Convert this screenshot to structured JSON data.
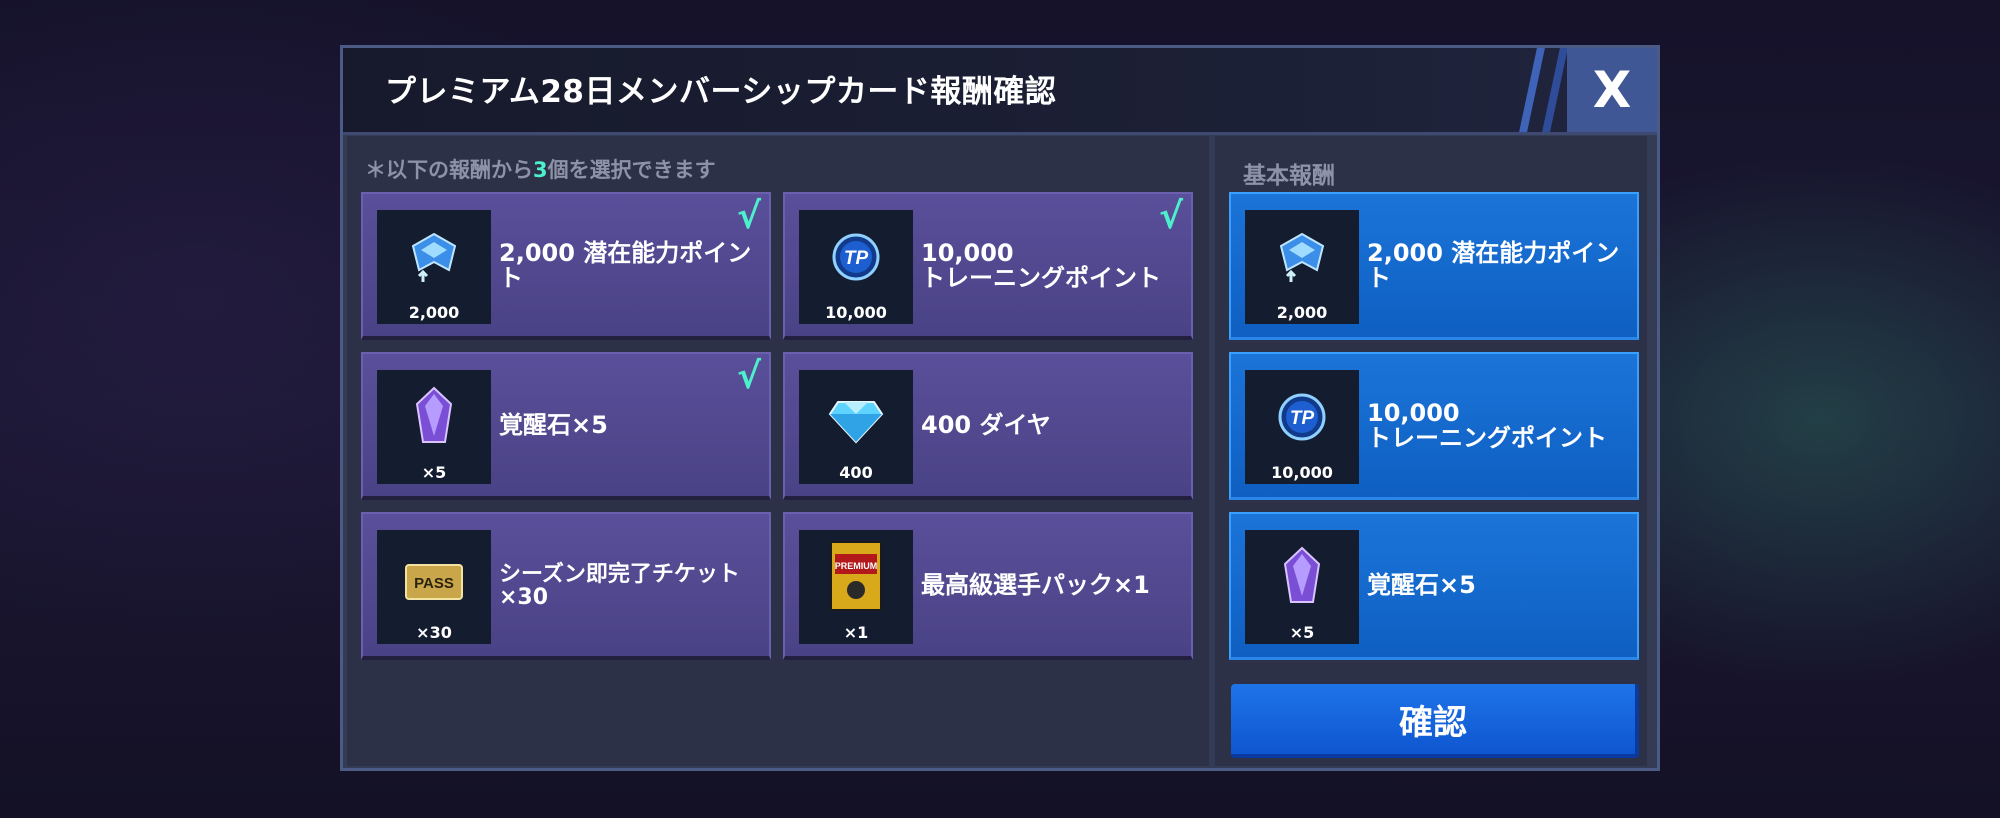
{
  "dialog": {
    "title": "プレミアム28日メンバーシップカード報酬確認",
    "close_label": "X"
  },
  "left": {
    "hint_pre": "＊以下の報酬から",
    "hint_num": "3",
    "hint_post": "個を選択できます",
    "cards": [
      {
        "icon": "potential-point-icon",
        "qty": "2,000",
        "label": "2,000 潜在能力ポイント",
        "selected": true
      },
      {
        "icon": "training-point-icon",
        "qty": "10,000",
        "label": "10,000\nトレーニングポイント",
        "selected": true
      },
      {
        "icon": "awakening-stone-icon",
        "qty": "×5",
        "label": "覚醒石×5",
        "selected": true
      },
      {
        "icon": "diamond-icon",
        "qty": "400",
        "label": "400 ダイヤ",
        "selected": false
      },
      {
        "icon": "season-pass-ticket-icon",
        "qty": "×30",
        "label": "シーズン即完了チケット×30",
        "selected": false
      },
      {
        "icon": "player-pack-icon",
        "qty": "×1",
        "label": "最高級選手パック×1",
        "selected": false
      }
    ],
    "check_mark": "√"
  },
  "right": {
    "heading": "基本報酬",
    "cards": [
      {
        "icon": "potential-point-icon",
        "qty": "2,000",
        "label": "2,000 潜在能力ポイント"
      },
      {
        "icon": "training-point-icon",
        "qty": "10,000",
        "label": "10,000\nトレーニングポイント"
      },
      {
        "icon": "awakening-stone-icon",
        "qty": "×5",
        "label": "覚醒石×5"
      }
    ],
    "confirm_label": "確認"
  },
  "icon_texts": {
    "tp": "TP",
    "pass": "PASS",
    "pack": "PREMIUM"
  }
}
